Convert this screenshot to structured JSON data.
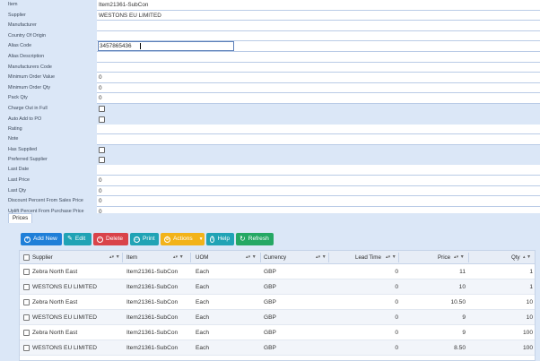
{
  "form": {
    "item": {
      "label": "Item",
      "value": "Item21361-SubCon"
    },
    "supplier": {
      "label": "Supplier",
      "value": "WESTONS EU LIMITED"
    },
    "manufacturer": {
      "label": "Manufacturer",
      "value": ""
    },
    "country_of_origin": {
      "label": "Country Of Origin",
      "value": ""
    },
    "alias_code": {
      "label": "Alias Code",
      "value": "3457865436"
    },
    "alias_description": {
      "label": "Alias Description",
      "value": ""
    },
    "manufacturers_code": {
      "label": "Manufacturers Code",
      "value": ""
    },
    "minimum_order_value": {
      "label": "Minimum Order Value",
      "value": "0"
    },
    "minimum_order_qty": {
      "label": "Minimum Order Qty",
      "value": "0"
    },
    "pack_qty": {
      "label": "Pack Qty",
      "value": "0"
    },
    "charge_out_in_full": {
      "label": "Charge Out in Full",
      "checked": false
    },
    "auto_add_to_po": {
      "label": "Auto Add to PO",
      "checked": false
    },
    "rating": {
      "label": "Rating",
      "value": ""
    },
    "note": {
      "label": "Note",
      "value": ""
    },
    "has_supplied": {
      "label": "Has Supplied",
      "checked": false
    },
    "preferred_supplier": {
      "label": "Preferred Supplier",
      "checked": false
    },
    "last_date": {
      "label": "Last Date",
      "value": ""
    },
    "last_price": {
      "label": "Last Price",
      "value": "0"
    },
    "last_qty": {
      "label": "Last Qty",
      "value": "0"
    },
    "discount_percent": {
      "label": "Discount Percent From Sales Price",
      "value": "0"
    },
    "uplift_percent": {
      "label": "Uplift Percent From Purchase Price",
      "value": "0"
    }
  },
  "tabs": {
    "prices": "Prices"
  },
  "toolbar": {
    "add_new": "Add New",
    "edit": "Edit",
    "delete": "Delete",
    "print": "Print",
    "actions": "Actions",
    "help": "Help",
    "refresh": "Refresh"
  },
  "grid": {
    "headers": {
      "supplier": "Supplier",
      "item": "Item",
      "uom": "UOM",
      "currency": "Currency",
      "lead_time": "Lead Time",
      "price": "Price",
      "qty": "Qty"
    },
    "rows": [
      {
        "supplier": "Zebra North East",
        "item": "Item21361-SubCon",
        "uom": "Each",
        "currency": "GBP",
        "lead_time": "0",
        "price": "11",
        "qty": "1"
      },
      {
        "supplier": "WESTONS EU LIMITED",
        "item": "Item21361-SubCon",
        "uom": "Each",
        "currency": "GBP",
        "lead_time": "0",
        "price": "10",
        "qty": "1"
      },
      {
        "supplier": "Zebra North East",
        "item": "Item21361-SubCon",
        "uom": "Each",
        "currency": "GBP",
        "lead_time": "0",
        "price": "10.50",
        "qty": "10"
      },
      {
        "supplier": "WESTONS EU LIMITED",
        "item": "Item21361-SubCon",
        "uom": "Each",
        "currency": "GBP",
        "lead_time": "0",
        "price": "9",
        "qty": "10"
      },
      {
        "supplier": "Zebra North East",
        "item": "Item21361-SubCon",
        "uom": "Each",
        "currency": "GBP",
        "lead_time": "0",
        "price": "9",
        "qty": "100"
      },
      {
        "supplier": "WESTONS EU LIMITED",
        "item": "Item21361-SubCon",
        "uom": "Each",
        "currency": "GBP",
        "lead_time": "0",
        "price": "8.50",
        "qty": "100"
      }
    ]
  },
  "colors": {
    "label_bg": "#dbe7f7",
    "add_button": "#1f7fd8",
    "edit_button": "#20a3b5",
    "delete_button": "#d9434a",
    "actions_button": "#f2b31a",
    "refresh_button": "#25a864"
  }
}
